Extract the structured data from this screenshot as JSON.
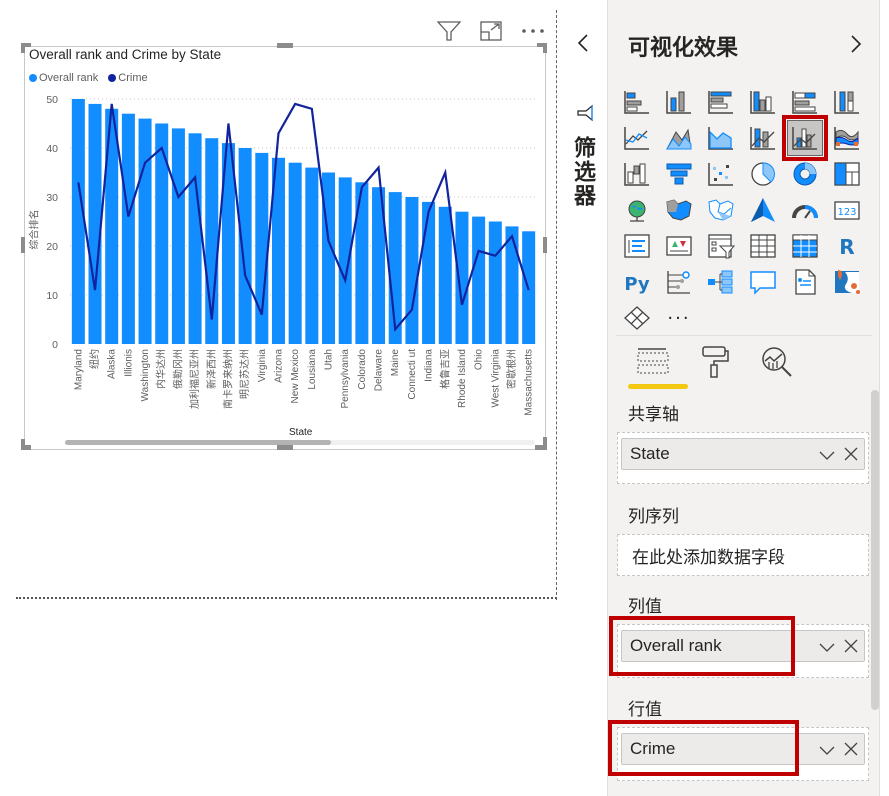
{
  "visual_header": {
    "filter_icon": "filter-icon",
    "focus_icon": "focus-mode-icon",
    "more_icon": "more-options-icon"
  },
  "chart_data": {
    "type": "bar+line",
    "title": "Overall rank and Crime by State",
    "xlabel": "State",
    "ylabel": "综合排名",
    "ylim": [
      0,
      50
    ],
    "yticks": [
      0,
      10,
      20,
      30,
      40,
      50
    ],
    "grid": true,
    "legend_position": "top-left",
    "categories": [
      "Maryland",
      "纽约",
      "Alaska",
      "Illionis",
      "Washington",
      "内华达州",
      "俄勒冈州",
      "加利福尼亚州",
      "新泽西州",
      "南卡罗来纳州",
      "明尼苏达州",
      "Virginia",
      "Arizona",
      "New Mexico",
      "Lousiana",
      "Utah",
      "Pennsylvania",
      "Colorado",
      "Delaware",
      "Maine",
      "Connecti ut",
      "Indiana",
      "格鲁吉亚",
      "Rhode Island",
      "Ohio",
      "West Virginia",
      "密歇根州",
      "Massachusetts"
    ],
    "series": [
      {
        "name": "Overall rank",
        "type": "bar",
        "color": "#118dff",
        "values": [
          50,
          49,
          48,
          47,
          46,
          45,
          44,
          43,
          42,
          41,
          40,
          39,
          38,
          37,
          36,
          35,
          34,
          33,
          32,
          31,
          30,
          29,
          28,
          27,
          26,
          25,
          24,
          23
        ]
      },
      {
        "name": "Crime",
        "type": "line",
        "color": "#12239e",
        "values": [
          33,
          11,
          49,
          26,
          37,
          40,
          30,
          34,
          5,
          45,
          14,
          6,
          43,
          49,
          48,
          21,
          13,
          32,
          36,
          3,
          7,
          27,
          35,
          8,
          19,
          18,
          22,
          11
        ]
      }
    ]
  },
  "filters_pane": {
    "label": "筛选器",
    "collapse_icon": "chevron-left-icon"
  },
  "viz_pane": {
    "title": "可视化效果",
    "expand_icon": "chevron-right-icon",
    "selected_visual": "line-and-clustered-column-chart",
    "more_label": "···",
    "tabs": [
      {
        "name": "fields",
        "icon": "fields-icon",
        "active": true
      },
      {
        "name": "format",
        "icon": "paint-roller-icon",
        "active": false
      },
      {
        "name": "analytics",
        "icon": "analytics-icon",
        "active": false
      }
    ],
    "wells": [
      {
        "label": "共享轴",
        "field": "State",
        "placeholder": null
      },
      {
        "label": "列序列",
        "field": null,
        "placeholder": "在此处添加数据字段"
      },
      {
        "label": "列值",
        "field": "Overall rank",
        "placeholder": null,
        "highlighted": true
      },
      {
        "label": "行值",
        "field": "Crime",
        "placeholder": null,
        "highlighted": true
      }
    ],
    "accent_color": "#f2c811",
    "highlight_color": "#c00000"
  }
}
